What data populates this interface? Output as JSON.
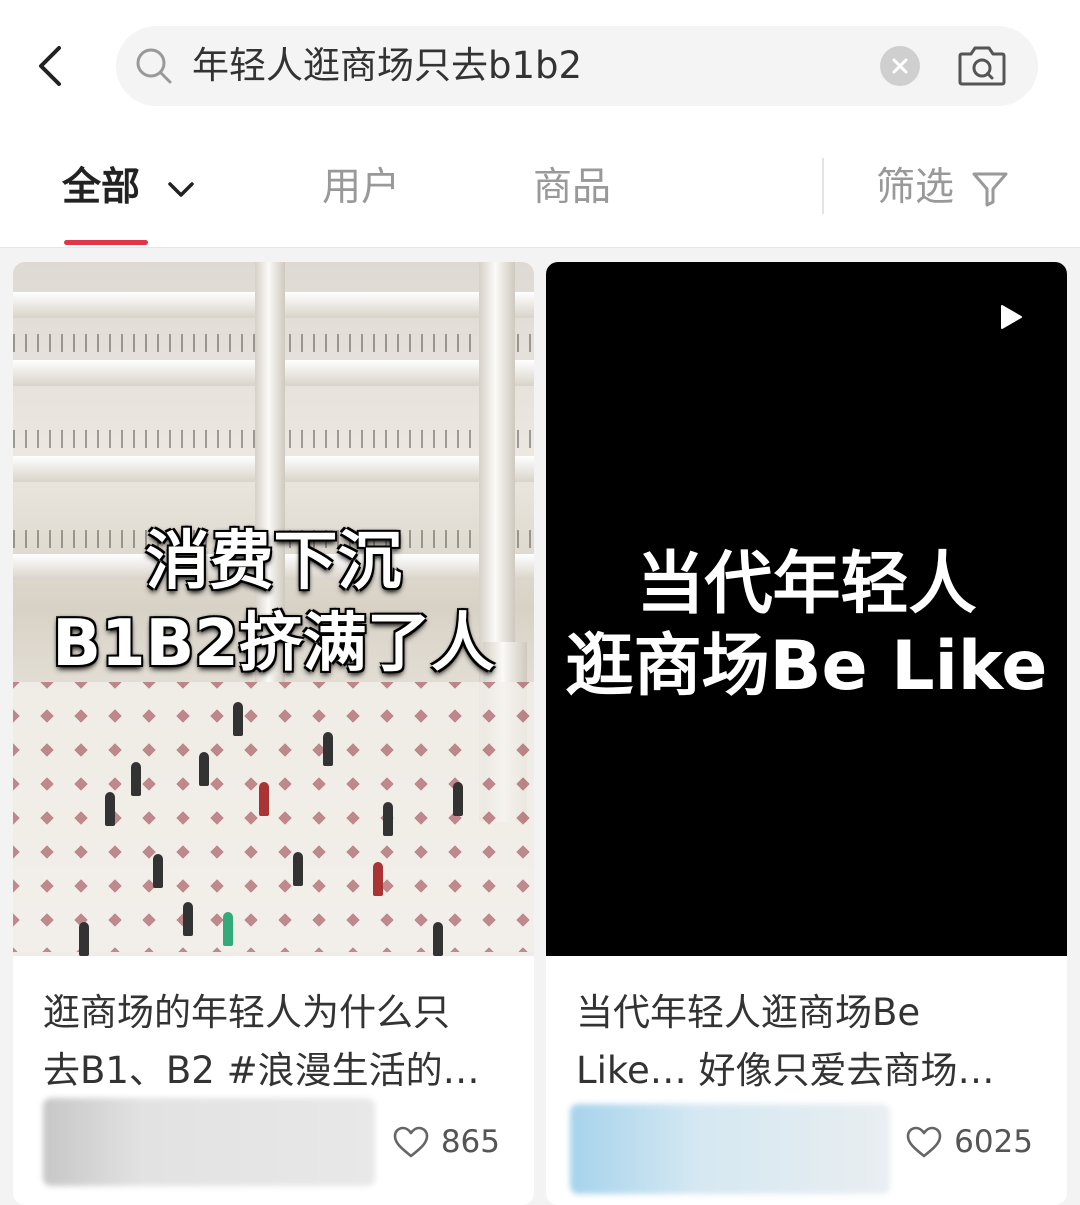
{
  "search": {
    "query": "年轻人逛商场只去b1b2"
  },
  "icons": {
    "back": "back-arrow-icon",
    "search": "search-icon",
    "clear": "clear-icon",
    "camera": "camera-search-icon",
    "dropdown": "chevron-down-icon",
    "filter": "filter-funnel-icon",
    "play": "play-icon",
    "like": "heart-icon"
  },
  "tabs": [
    {
      "label": "全部",
      "active": true
    },
    {
      "label": "用户",
      "active": false
    },
    {
      "label": "商品",
      "active": false
    }
  ],
  "filter": {
    "label": "筛选"
  },
  "colors": {
    "accent": "#e0364a",
    "background": "#f3f3f3",
    "card": "#ffffff"
  },
  "feed": [
    {
      "type": "image",
      "overlay_lines": [
        "消费下沉",
        "B1B2挤满了人"
      ],
      "title_lines": [
        "逛商场的年轻人为什么只",
        "去B1、B2 #浪漫生活的…"
      ],
      "likes": "865"
    },
    {
      "type": "video",
      "overlay_lines": [
        "当代年轻人",
        "逛商场Be Like"
      ],
      "title_lines": [
        "当代年轻人逛商场Be",
        "Like… 好像只爱去商场…"
      ],
      "likes": "6025"
    }
  ]
}
